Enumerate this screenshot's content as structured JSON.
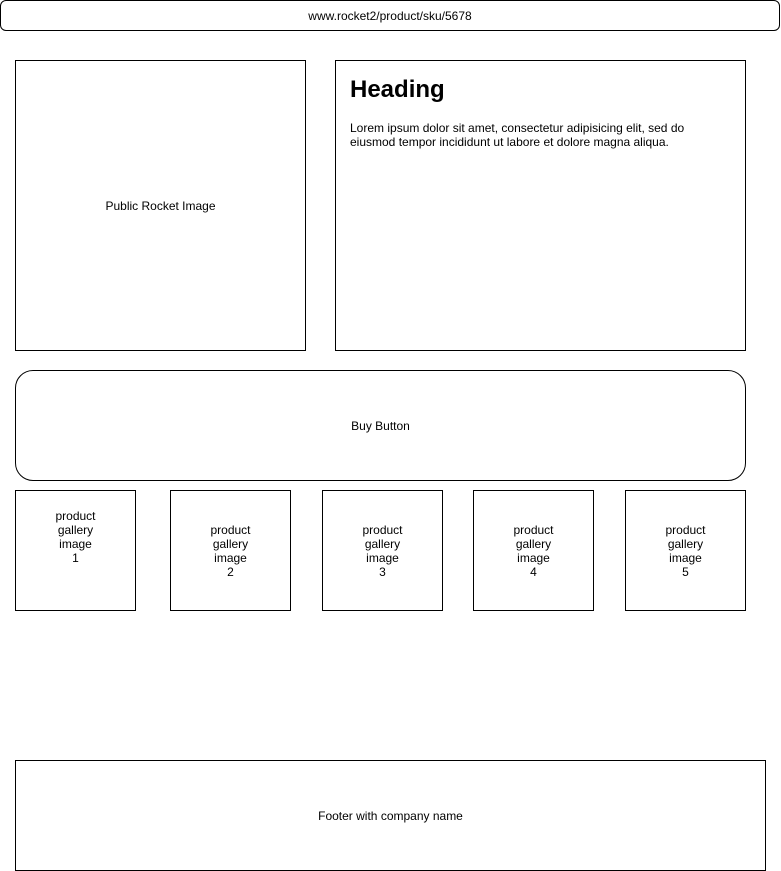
{
  "url_bar": {
    "text": "www.rocket2/product/sku/5678"
  },
  "hero": {
    "image_label": "Public Rocket Image"
  },
  "info": {
    "heading": "Heading",
    "body": "Lorem ipsum dolor sit amet, consectetur adipisicing elit, sed do eiusmod tempor incididunt ut labore et dolore magna aliqua."
  },
  "buy": {
    "label": "Buy Button"
  },
  "gallery": {
    "items": [
      {
        "line1": "product",
        "line2": "gallery",
        "line3": "image",
        "line4": "1"
      },
      {
        "line1": "product",
        "line2": "gallery",
        "line3": "image",
        "line4": "2"
      },
      {
        "line1": "product",
        "line2": "gallery",
        "line3": "image",
        "line4": "3"
      },
      {
        "line1": "product",
        "line2": "gallery",
        "line3": "image",
        "line4": "4"
      },
      {
        "line1": "product",
        "line2": "gallery",
        "line3": "image",
        "line4": "5"
      }
    ]
  },
  "footer": {
    "label": "Footer with company name"
  }
}
